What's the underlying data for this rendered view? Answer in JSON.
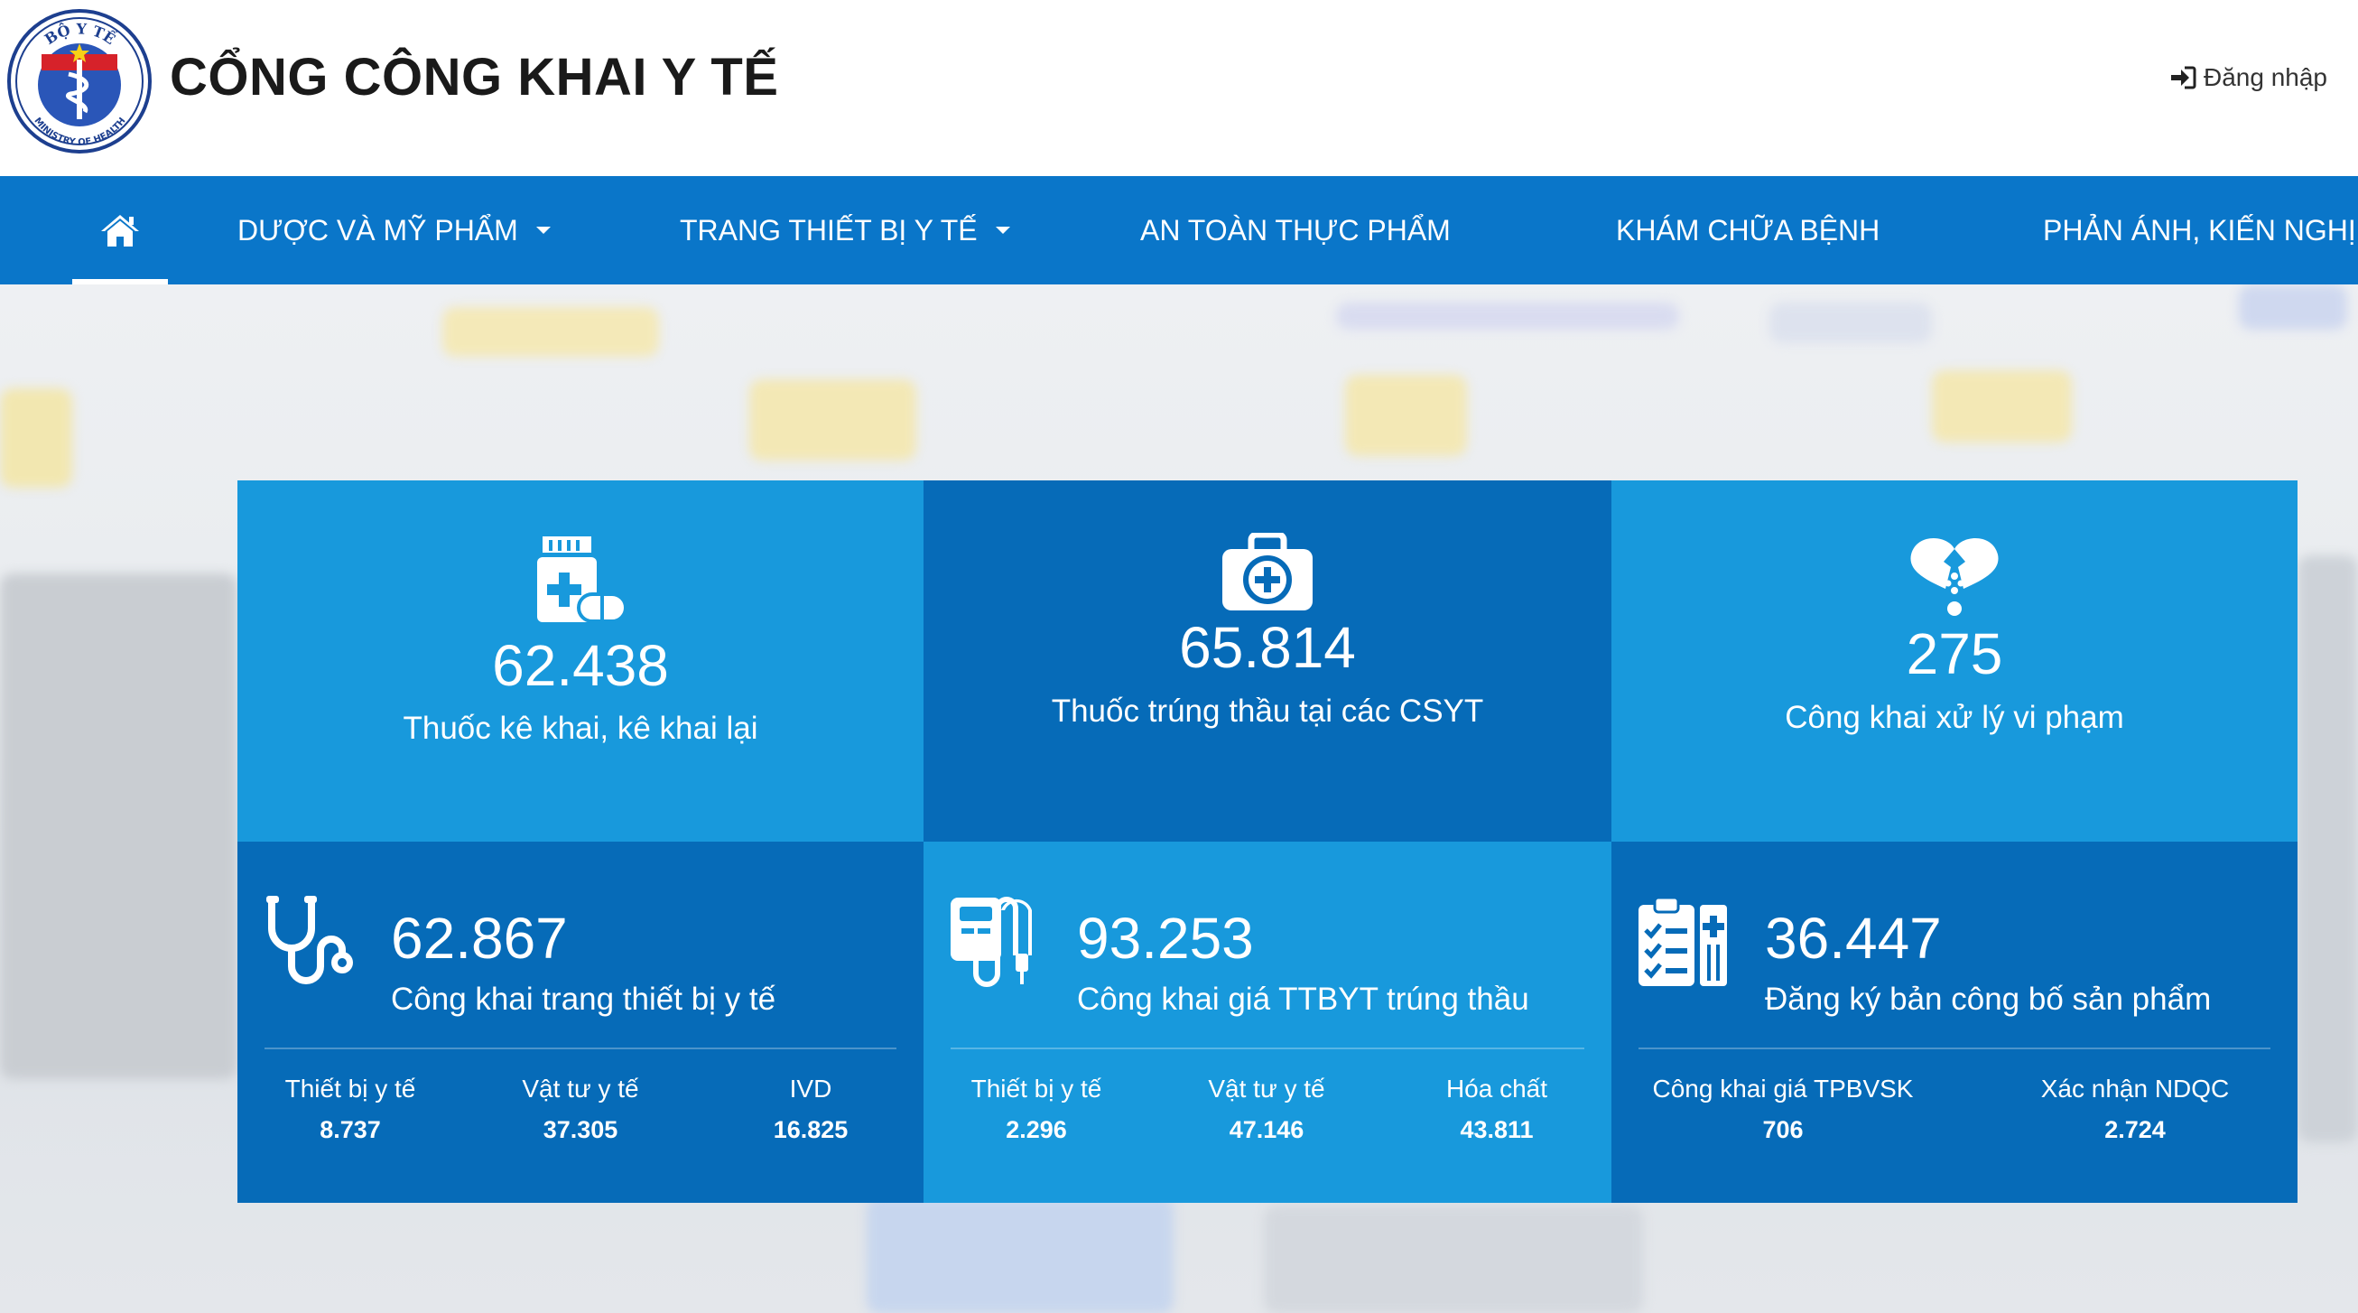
{
  "header": {
    "logo_text_top": "BỘ Y TẾ",
    "logo_text_bottom": "MINISTRY OF HEALTH",
    "title": "CỔNG CÔNG KHAI Y TẾ",
    "login_label": "Đăng nhập"
  },
  "nav": {
    "items": [
      {
        "label": "DƯỢC VÀ MỸ PHẨM",
        "dropdown": true
      },
      {
        "label": "TRANG THIẾT BỊ Y TẾ",
        "dropdown": true
      },
      {
        "label": "AN TOÀN THỰC PHẨM",
        "dropdown": false
      },
      {
        "label": "KHÁM CHỮA BỆNH",
        "dropdown": false
      },
      {
        "label": "PHẢN ÁNH, KIẾN NGHỊ",
        "dropdown": false
      }
    ]
  },
  "stats": {
    "top": [
      {
        "value": "62.438",
        "label": "Thuốc kê khai, kê khai lại",
        "icon": "medicine-bottle-icon"
      },
      {
        "value": "65.814",
        "label": "Thuốc trúng thầu tại các CSYT",
        "icon": "first-aid-kit-icon"
      },
      {
        "value": "275",
        "label": "Công khai xử lý vi phạm",
        "icon": "broken-heart-icon"
      }
    ],
    "bottom": [
      {
        "value": "62.867",
        "label": "Công khai trang thiết bị y tế",
        "icon": "stethoscope-icon",
        "subs": [
          {
            "label": "Thiết bị y tế",
            "value": "8.737"
          },
          {
            "label": "Vật tư y tế",
            "value": "37.305"
          },
          {
            "label": "IVD",
            "value": "16.825"
          }
        ]
      },
      {
        "value": "93.253",
        "label": "Công khai giá TTBYT trúng thầu",
        "icon": "infusion-device-icon",
        "subs": [
          {
            "label": "Thiết bị y tế",
            "value": "2.296"
          },
          {
            "label": "Vật tư y tế",
            "value": "47.146"
          },
          {
            "label": "Hóa chất",
            "value": "43.811"
          }
        ]
      },
      {
        "value": "36.447",
        "label": "Đăng ký bản công bố sản phẩm",
        "icon": "clipboard-checklist-icon",
        "subs": [
          {
            "label": "Công khai giá TPBVSK",
            "value": "706"
          },
          {
            "label": "Xác nhận NDQC",
            "value": "2.724"
          }
        ]
      }
    ]
  },
  "colors": {
    "nav_bg": "#0a76c9",
    "tile_light": "#1899dc",
    "tile_dark": "#066bb8"
  }
}
